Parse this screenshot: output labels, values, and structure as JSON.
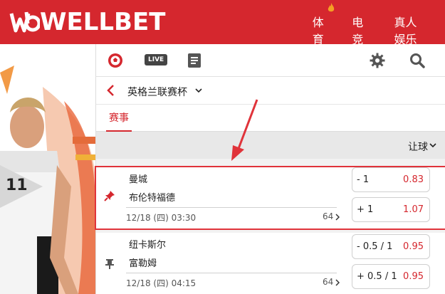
{
  "brand": {
    "logo_text": "WELLBET",
    "color": "#d5272e"
  },
  "nav": [
    {
      "label": "体育"
    },
    {
      "label": "电竞"
    },
    {
      "label": "真人娱乐"
    }
  ],
  "toolbar": {
    "icons": [
      "soccer-ball-icon",
      "live-icon",
      "list-icon",
      "gear-icon",
      "search-icon"
    ],
    "live_label": "LIVE"
  },
  "league": {
    "name": "英格兰联赛杯"
  },
  "tabs": {
    "active": "赛事"
  },
  "market": {
    "label": "让球"
  },
  "matches": [
    {
      "home": "曼城",
      "away": "布伦特福德",
      "datetime": "12/18 (四) 03:30",
      "count": "64",
      "odds": [
        {
          "handicap": "- 1",
          "value": "0.83"
        },
        {
          "handicap": "+ 1",
          "value": "1.07"
        }
      ]
    },
    {
      "home": "纽卡斯尔",
      "away": "富勒姆",
      "datetime": "12/18 (四) 04:15",
      "count": "64",
      "odds": [
        {
          "handicap": "- 0.5 / 1",
          "value": "0.95"
        },
        {
          "handicap": "+ 0.5 / 1",
          "value": "0.95"
        }
      ]
    }
  ]
}
